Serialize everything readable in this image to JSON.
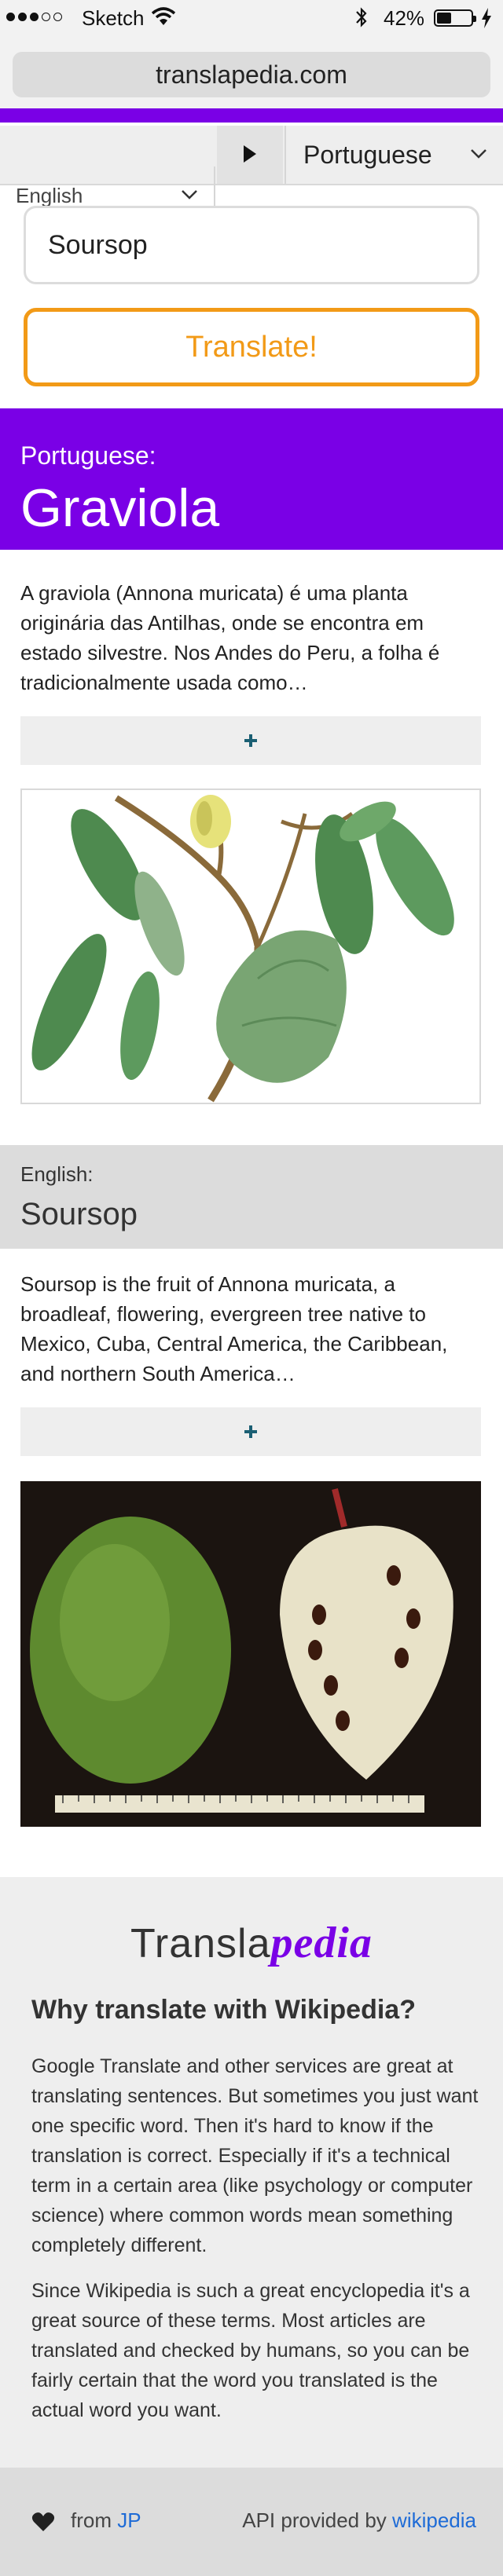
{
  "status_bar": {
    "carrier": "Sketch",
    "battery_percent": "42%",
    "battery_level": 0.42,
    "signal_bars_filled": 3,
    "signal_bars_total": 5
  },
  "browser": {
    "url": "translapedia.com"
  },
  "language_bar": {
    "from_language": "English",
    "to_language": "Portuguese",
    "swap_icon": "play-triangle-icon"
  },
  "search": {
    "value": "Soursop",
    "button_label": "Translate!"
  },
  "target_result": {
    "language_label": "Portuguese:",
    "word": "Graviola",
    "summary": "A graviola (Annona muricata) é uma planta originária das Antilhas, onde se encontra em estado silvestre. Nos Andes do Peru, a folha é tradicionalmente usada como…",
    "more_icon": "plus-icon"
  },
  "source_result": {
    "language_label": "English:",
    "word": "Soursop",
    "summary": "Soursop is the fruit of Annona muricata, a broadleaf, flowering, evergreen tree native to Mexico, Cuba, Central America, the Caribbean, and northern South America…",
    "more_icon": "plus-icon"
  },
  "about": {
    "logo_part1": "Transla",
    "logo_part2": "pedia",
    "heading": "Why translate with Wikipedia?",
    "paragraph1": "Google Translate and other services are great at translating sentences. But sometimes you just want one specific word. Then it's hard to know if the translation is correct. Especially if it's a technical term in a certain area (like psychology or computer science) where common words mean something completely different.",
    "paragraph2": "Since Wikipedia is such a great encyclopedia it's a great source of these terms. Most articles are translated and checked by humans, so you can be fairly certain that the word you translated is the actual word you want."
  },
  "footer": {
    "from_text": "from",
    "author_link": "JP",
    "api_text": "API provided by",
    "api_link": "wikipedia"
  },
  "colors": {
    "accent_purple": "#7a00e6",
    "button_orange": "#f29a17",
    "link_blue": "#1e6bd6",
    "plus_teal": "#1a5f73"
  }
}
